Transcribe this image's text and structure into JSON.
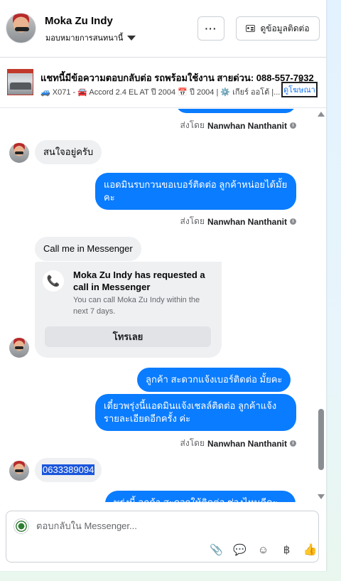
{
  "header": {
    "contact_name": "Moka Zu Indy",
    "assign_label": "มอบหมายการสนทนานี้",
    "more_label": "···",
    "contact_info_label": "ดูข้อมูลติดต่อ"
  },
  "ad": {
    "title": "แชทนี้มีข้อความตอบกลับต่อ รถพร้อมใช้งาน สายด่วน: 088-557-7932",
    "meta": "🚙 X071 - 🚘 Accord 2.4 EL AT ปี 2004 📅 ปี 2004 | ⚙️ เกียร์ ออโต้ |...",
    "link_label": "ดูโฆษณา",
    "close_icon": "×"
  },
  "messages": {
    "sent_by_prefix": "ส่งโดย",
    "agent_name": "Nanwhan Nanthanit",
    "info_icon": "i",
    "msg1_in": "สนใจอยู่ครับ",
    "msg2_out": "แอดมินรบกวนขอเบอร์ติดต่อ ลูกค้าหน่อยได้มั้ยคะ",
    "msg3_in": "Call me in Messenger",
    "call_card": {
      "title": "Moka Zu Indy has requested a call in Messenger",
      "subtitle": "You can call Moka Zu Indy within the next 7 days.",
      "button": "โทรเลย",
      "phone_icon": "📞"
    },
    "msg4_out": "ลูกค้า สะดวกแจ้งเบอร์ติดต่อ มั้ยคะ",
    "msg5_out": "เดี๋ยวพรุ่งนี้แอดมินแจ้งเชลล์ติดต่อ ลูกค้าแจ้งรายละเอียดอีกครั้ง ค่ะ",
    "msg6_in": "0633389094",
    "msg7_out_partial": "พรุ่งนี้ ลูกค้า สะดวกให้ติดต่อ ช่วงไหนดีคะ"
  },
  "composer": {
    "placeholder": "ตอบกลับใน Messenger...",
    "tools": {
      "attach_icon": "📎",
      "saved_reply_icon": "💬",
      "emoji_icon": "☺",
      "payment_icon": "฿",
      "like_icon": "👍"
    }
  }
}
